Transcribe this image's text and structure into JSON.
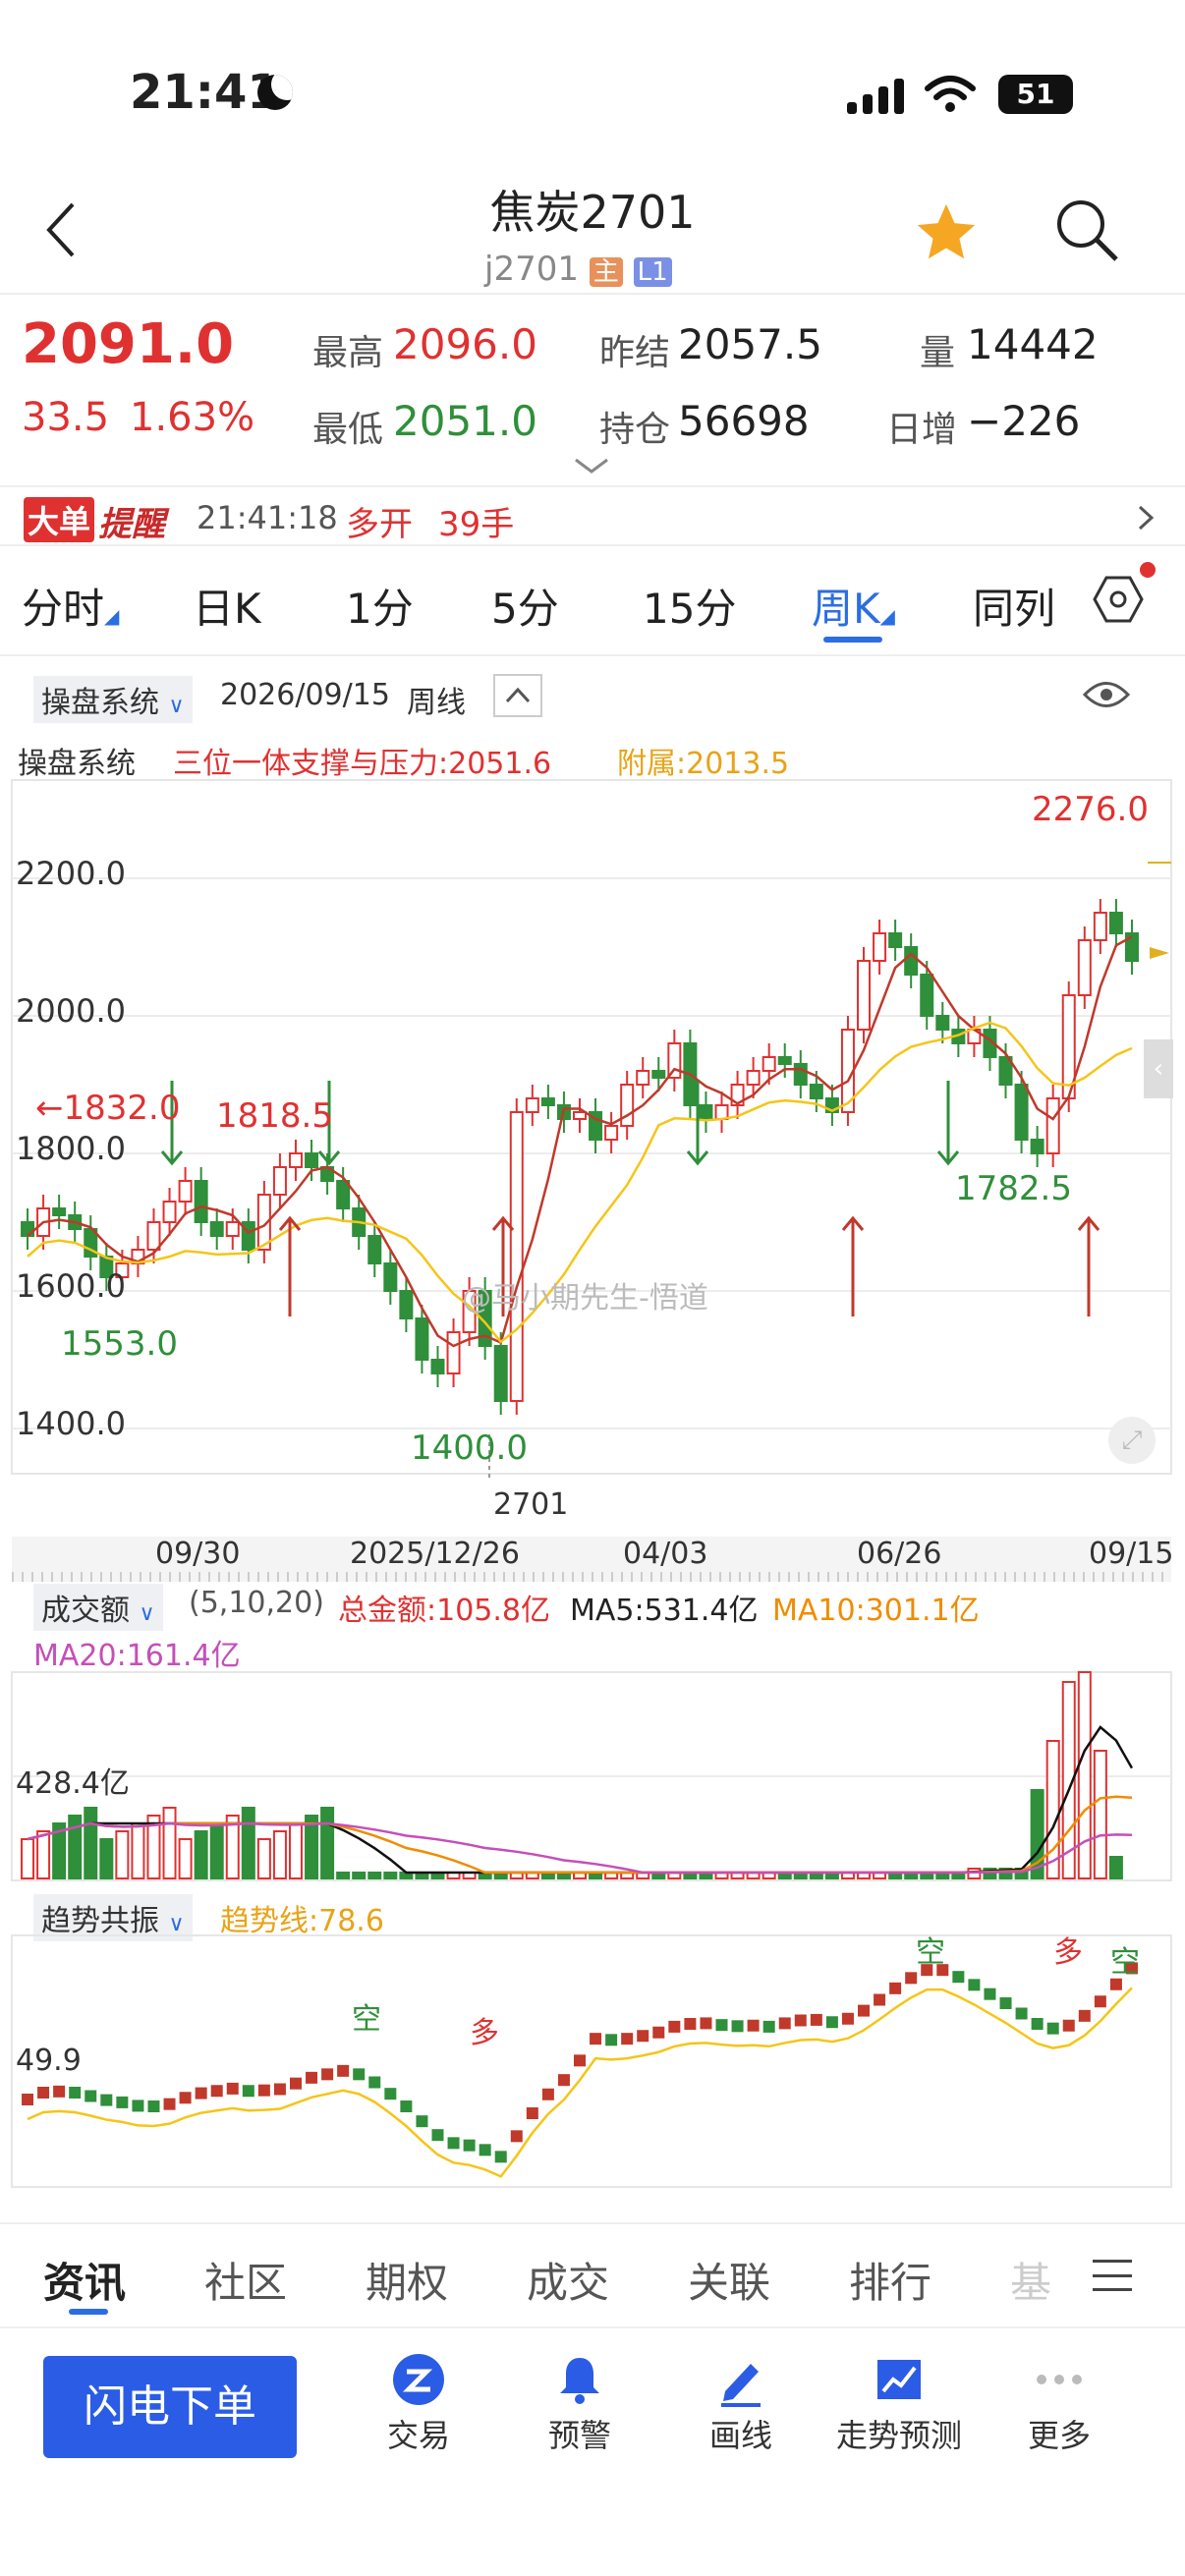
{
  "status": {
    "time": "21:41",
    "battery": "51"
  },
  "header": {
    "title": "焦炭2701",
    "code": "j2701",
    "badge_main": "主",
    "badge_l1": "L1"
  },
  "quote": {
    "price": "2091.0",
    "change": "33.5",
    "pct": "1.63%",
    "high_label": "最高",
    "high": "2096.0",
    "low_label": "最低",
    "low": "2051.0",
    "prev_label": "昨结",
    "prev": "2057.5",
    "oi_label": "持仓",
    "oi": "56698",
    "vol_label": "量",
    "vol": "14442",
    "daily_label": "日增",
    "daily": "−226"
  },
  "alert": {
    "tag1": "大单",
    "tag2": "提醒",
    "time": "21:41:18",
    "action": "多开",
    "qty": "39手"
  },
  "tabs": {
    "t1": "分时",
    "t2": "日K",
    "t3": "1分",
    "t4": "5分",
    "t5": "15分",
    "t6": "周K",
    "t7": "同列"
  },
  "chart_head": {
    "system": "操盘系统",
    "date": "2026/09/15",
    "period": "周线",
    "ind_name": "操盘系统",
    "ind1": "三位一体支撑与压力:2051.6",
    "ind2": "附属:2013.5"
  },
  "main_chart": {
    "y1": "2200.0",
    "y2": "2000.0",
    "y3": "1800.0",
    "y4": "1600.0",
    "y5": "1400.0",
    "a1": "←1832.0",
    "a2": "1818.5",
    "a3": "1553.0",
    "a4": "1400.0",
    "a5": "2276.0",
    "a6": "1782.5",
    "watermark": "@马小期先生-悟道",
    "contract": "2701"
  },
  "xaxis": {
    "d1": "09/30",
    "d2": "2025/12/26",
    "d3": "04/03",
    "d4": "06/26",
    "d5": "09/15"
  },
  "vol_head": {
    "name": "成交额",
    "params": "(5,10,20)",
    "total": "总金额:105.8亿",
    "ma5": "MA5:531.4亿",
    "ma10": "MA10:301.1亿",
    "ma20": "MA20:161.4亿",
    "ylabel": "428.4亿"
  },
  "trend_head": {
    "name": "趋势共振",
    "line": "趋势线:78.6",
    "ylabel": "49.9",
    "l1": "空",
    "l2": "多",
    "l3": "空",
    "l4": "多",
    "l5": "空"
  },
  "bottom_tabs": {
    "b1": "资讯",
    "b2": "社区",
    "b3": "期权",
    "b4": "成交",
    "b5": "关联",
    "b6": "排行",
    "b7": "基"
  },
  "action_bar": {
    "order": "闪电下单",
    "a1": "交易",
    "a2": "预警",
    "a3": "画线",
    "a4": "走势预测",
    "a5": "更多"
  },
  "chart_data": {
    "type": "candlestick",
    "period": "weekly",
    "x_range": [
      "09/30",
      "09/15"
    ],
    "y_ticks": [
      2200,
      2000,
      1800,
      1600,
      1400
    ],
    "max": 2276.0,
    "min": 1400.0,
    "annotations": [
      1832.0,
      1818.5,
      1553.0,
      1400.0,
      2276.0,
      1782.5
    ],
    "support_pressure": 2051.6,
    "auxiliary": 2013.5,
    "volume": {
      "total_yi": 105.8,
      "ma5_yi": 531.4,
      "ma10_yi": 301.1,
      "ma20_yi": 161.4,
      "tick_yi": 428.4
    },
    "trend_line": 78.6,
    "trend_tick": 49.9
  }
}
